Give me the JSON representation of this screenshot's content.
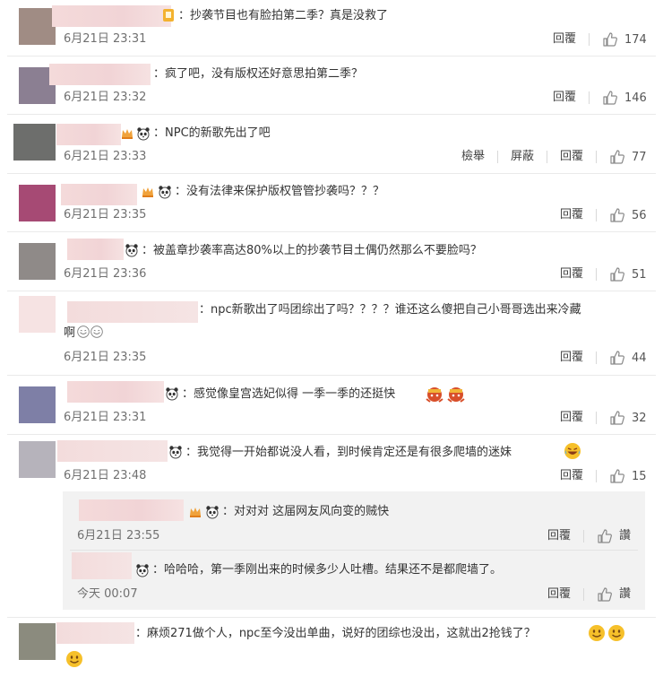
{
  "comments": [
    {
      "text": "：抄袭节目也有脸拍第二季？真是没救了",
      "time": "6月21日 23:31",
      "reply": "回覆",
      "likes": "174",
      "avatar_color": "#a08c84"
    },
    {
      "text": "：疯了吧，没有版权还好意思拍第二季？",
      "time": "6月21日 23:32",
      "reply": "回覆",
      "likes": "146",
      "avatar_color": "#8b7f92"
    },
    {
      "text": "：NPC的新歌先出了吧",
      "time": "6月21日 23:33",
      "report": "檢舉",
      "block": "屏蔽",
      "reply": "回覆",
      "likes": "77",
      "avatar_color": "#6d6e6c"
    },
    {
      "text": "：没有法律来保护版权管管抄袭吗？？？",
      "time": "6月21日 23:35",
      "reply": "回覆",
      "likes": "56",
      "avatar_color": "#a64a74"
    },
    {
      "text": "：被盖章抄袭率高达80%以上的抄袭节目土偶仍然那么不要脸吗？",
      "time": "6月21日 23:36",
      "reply": "回覆",
      "likes": "51",
      "avatar_color": "#8f8a88"
    },
    {
      "text": "：npc新歌出了吗团综出了吗？？？？谁还这么傻把自己小哥哥选出来冷藏",
      "text2": "啊",
      "time": "6月21日 23:35",
      "reply": "回覆",
      "likes": "44",
      "avatar_color": "#f6e3e3"
    },
    {
      "text": "：感觉像皇宫选妃似得 一季一季的还挺快",
      "time": "6月21日 23:31",
      "reply": "回覆",
      "likes": "32",
      "avatar_color": "#7e7fa6"
    },
    {
      "text": "：我觉得一开始都说没人看，到时候肯定还是有很多爬墙的迷妹",
      "time": "6月21日 23:48",
      "reply": "回覆",
      "likes": "15",
      "avatar_color": "#b6b3bb"
    }
  ],
  "replies": [
    {
      "text": "：对对对 这届网友风向变的贼快",
      "time": "6月21日 23:55",
      "reply": "回覆",
      "like": "讚"
    },
    {
      "text": "：哈哈哈，第一季刚出来的时候多少人吐槽。结果还不是都爬墙了。",
      "time": "今天 00:07",
      "reply": "回覆",
      "like": "讚"
    }
  ],
  "last_comment": {
    "text": "：麻烦271做个人，npc至今没出单曲，说好的团综也没出，这就出2抢钱了？",
    "avatar_color": "#8b8b7e"
  },
  "colors": {
    "link": "#eb7350",
    "muted": "#808080",
    "icon": "#909090"
  },
  "icons": {
    "like": "thumbs-up-icon",
    "panda": "panda-badge-icon",
    "crown": "fan-badge-icon"
  }
}
